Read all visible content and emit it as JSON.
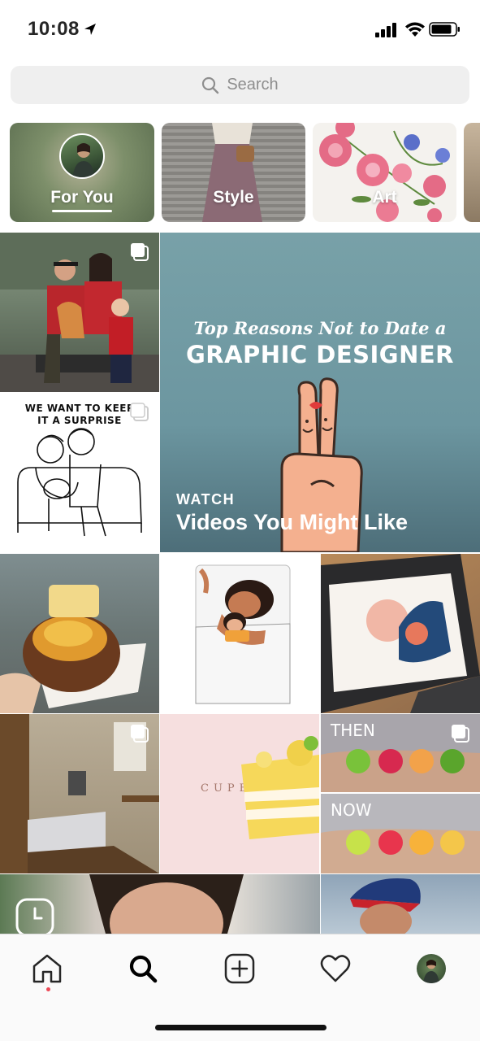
{
  "status_bar": {
    "time": "10:08",
    "icons": [
      "location-arrow-icon",
      "cellular-signal-icon",
      "wifi-icon",
      "battery-icon"
    ]
  },
  "search": {
    "placeholder": "Search",
    "icon": "search-icon"
  },
  "categories": [
    {
      "label": "For You",
      "selected": true
    },
    {
      "label": "Style",
      "selected": false
    },
    {
      "label": "Art",
      "selected": false
    }
  ],
  "feed": {
    "video_section": {
      "kicker": "WATCH",
      "title": "Videos You Might Like",
      "artwork_line1": "Top Reasons Not to Date a",
      "artwork_line2": "GRAPHIC DESIGNER"
    },
    "comic_caption_line1": "WE WANT TO KEEP",
    "comic_caption_line2": "IT A SURPRISE",
    "then_label": "THEN",
    "now_label": "NOW",
    "cupetit_label": "CUPETIT"
  },
  "tab_bar": {
    "items": [
      "home-icon",
      "search-icon",
      "new-post-icon",
      "activity-heart-icon",
      "profile-avatar"
    ],
    "active": "search-icon",
    "notification_dot_color": "#ed4956"
  }
}
